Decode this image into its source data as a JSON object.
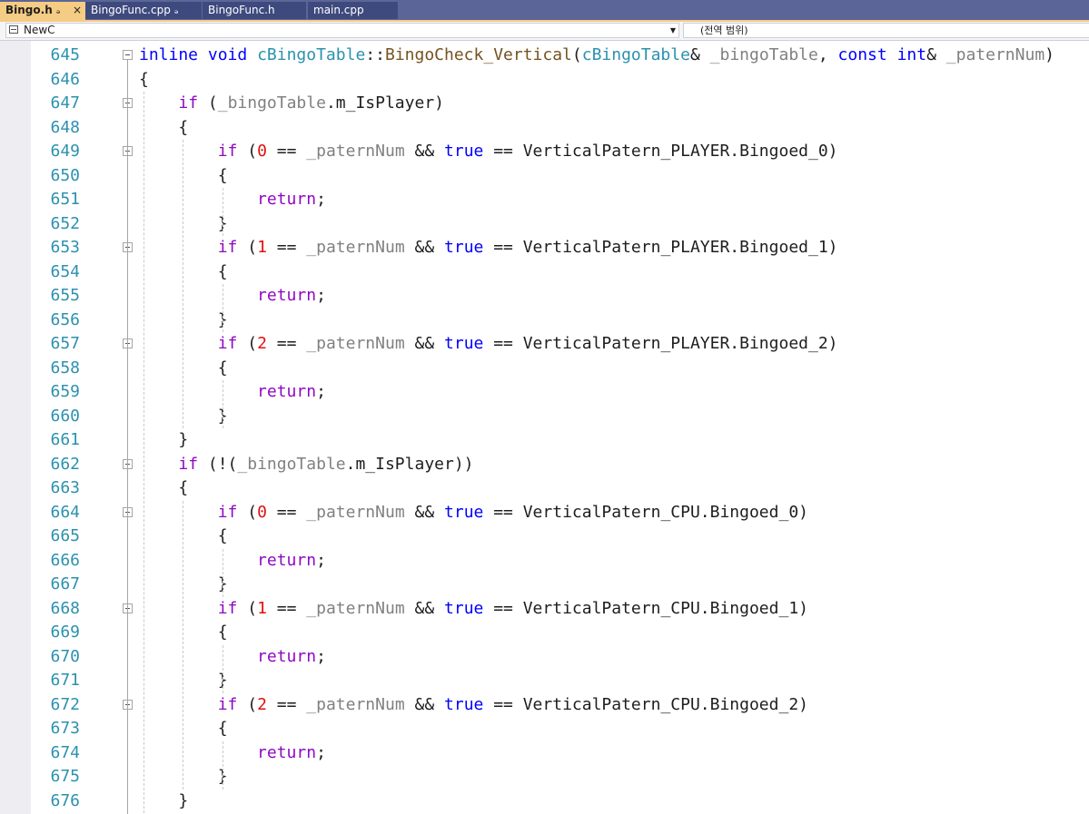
{
  "tabs": [
    {
      "label": "Bingo.h",
      "active": true,
      "pinned": true,
      "close": "×"
    },
    {
      "label": "BingoFunc.cpp",
      "active": false,
      "pinned": true
    },
    {
      "label": "BingoFunc.h",
      "active": false,
      "pinned": false
    },
    {
      "label": "main.cpp",
      "active": false,
      "pinned": false
    }
  ],
  "pin_glyph": "ₔ",
  "navbar": {
    "scope_left": "NewC",
    "scope_right": "(전역 범위)"
  },
  "colors": {
    "line_numbers": "#2b91af",
    "keyword": "#0000ff",
    "control_keyword": "#8f08c4",
    "type": "#2b91af",
    "parameter": "#808080",
    "number_literal": "#e01010"
  },
  "editor": {
    "lines": [
      {
        "num": "645",
        "fold": true,
        "tokens": [
          [
            "kw",
            "inline"
          ],
          [
            "plain",
            " "
          ],
          [
            "kw",
            "void"
          ],
          [
            "plain",
            " "
          ],
          [
            "type",
            "cBingoTable"
          ],
          [
            "plain",
            "::"
          ],
          [
            "func",
            "BingoCheck_Vertical"
          ],
          [
            "plain",
            "("
          ],
          [
            "type",
            "cBingoTable"
          ],
          [
            "plain",
            "& "
          ],
          [
            "param",
            "_bingoTable"
          ],
          [
            "plain",
            ", "
          ],
          [
            "kw",
            "const"
          ],
          [
            "plain",
            " "
          ],
          [
            "kw",
            "int"
          ],
          [
            "plain",
            "& "
          ],
          [
            "param",
            "_paternNum"
          ],
          [
            "plain",
            ")"
          ]
        ]
      },
      {
        "num": "646",
        "fold": false,
        "tokens": [
          [
            "plain",
            "{"
          ]
        ]
      },
      {
        "num": "647",
        "fold": true,
        "tokens": [
          [
            "plain",
            "    "
          ],
          [
            "ctl",
            "if"
          ],
          [
            "plain",
            " ("
          ],
          [
            "param",
            "_bingoTable"
          ],
          [
            "plain",
            ".m_IsPlayer)"
          ]
        ]
      },
      {
        "num": "648",
        "fold": false,
        "tokens": [
          [
            "plain",
            "    {"
          ]
        ]
      },
      {
        "num": "649",
        "fold": true,
        "tokens": [
          [
            "plain",
            "        "
          ],
          [
            "ctl",
            "if"
          ],
          [
            "plain",
            " ("
          ],
          [
            "num",
            "0"
          ],
          [
            "plain",
            " == "
          ],
          [
            "param",
            "_paternNum"
          ],
          [
            "plain",
            " && "
          ],
          [
            "kw",
            "true"
          ],
          [
            "plain",
            " == VerticalPatern_PLAYER.Bingoed_0)"
          ]
        ]
      },
      {
        "num": "650",
        "fold": false,
        "tokens": [
          [
            "plain",
            "        {"
          ]
        ]
      },
      {
        "num": "651",
        "fold": false,
        "tokens": [
          [
            "plain",
            "            "
          ],
          [
            "ctl",
            "return"
          ],
          [
            "plain",
            ";"
          ]
        ]
      },
      {
        "num": "652",
        "fold": false,
        "tokens": [
          [
            "plain",
            "        }"
          ]
        ]
      },
      {
        "num": "653",
        "fold": true,
        "tokens": [
          [
            "plain",
            "        "
          ],
          [
            "ctl",
            "if"
          ],
          [
            "plain",
            " ("
          ],
          [
            "num",
            "1"
          ],
          [
            "plain",
            " == "
          ],
          [
            "param",
            "_paternNum"
          ],
          [
            "plain",
            " && "
          ],
          [
            "kw",
            "true"
          ],
          [
            "plain",
            " == VerticalPatern_PLAYER.Bingoed_1)"
          ]
        ]
      },
      {
        "num": "654",
        "fold": false,
        "tokens": [
          [
            "plain",
            "        {"
          ]
        ]
      },
      {
        "num": "655",
        "fold": false,
        "tokens": [
          [
            "plain",
            "            "
          ],
          [
            "ctl",
            "return"
          ],
          [
            "plain",
            ";"
          ]
        ]
      },
      {
        "num": "656",
        "fold": false,
        "tokens": [
          [
            "plain",
            "        }"
          ]
        ]
      },
      {
        "num": "657",
        "fold": true,
        "tokens": [
          [
            "plain",
            "        "
          ],
          [
            "ctl",
            "if"
          ],
          [
            "plain",
            " ("
          ],
          [
            "num",
            "2"
          ],
          [
            "plain",
            " == "
          ],
          [
            "param",
            "_paternNum"
          ],
          [
            "plain",
            " && "
          ],
          [
            "kw",
            "true"
          ],
          [
            "plain",
            " == VerticalPatern_PLAYER.Bingoed_2)"
          ]
        ]
      },
      {
        "num": "658",
        "fold": false,
        "tokens": [
          [
            "plain",
            "        {"
          ]
        ]
      },
      {
        "num": "659",
        "fold": false,
        "tokens": [
          [
            "plain",
            "            "
          ],
          [
            "ctl",
            "return"
          ],
          [
            "plain",
            ";"
          ]
        ]
      },
      {
        "num": "660",
        "fold": false,
        "tokens": [
          [
            "plain",
            "        }"
          ]
        ]
      },
      {
        "num": "661",
        "fold": false,
        "tokens": [
          [
            "plain",
            "    }"
          ]
        ]
      },
      {
        "num": "662",
        "fold": true,
        "tokens": [
          [
            "plain",
            "    "
          ],
          [
            "ctl",
            "if"
          ],
          [
            "plain",
            " (!("
          ],
          [
            "param",
            "_bingoTable"
          ],
          [
            "plain",
            ".m_IsPlayer))"
          ]
        ]
      },
      {
        "num": "663",
        "fold": false,
        "tokens": [
          [
            "plain",
            "    {"
          ]
        ]
      },
      {
        "num": "664",
        "fold": true,
        "tokens": [
          [
            "plain",
            "        "
          ],
          [
            "ctl",
            "if"
          ],
          [
            "plain",
            " ("
          ],
          [
            "num",
            "0"
          ],
          [
            "plain",
            " == "
          ],
          [
            "param",
            "_paternNum"
          ],
          [
            "plain",
            " && "
          ],
          [
            "kw",
            "true"
          ],
          [
            "plain",
            " == VerticalPatern_CPU.Bingoed_0)"
          ]
        ]
      },
      {
        "num": "665",
        "fold": false,
        "tokens": [
          [
            "plain",
            "        {"
          ]
        ]
      },
      {
        "num": "666",
        "fold": false,
        "tokens": [
          [
            "plain",
            "            "
          ],
          [
            "ctl",
            "return"
          ],
          [
            "plain",
            ";"
          ]
        ]
      },
      {
        "num": "667",
        "fold": false,
        "tokens": [
          [
            "plain",
            "        }"
          ]
        ]
      },
      {
        "num": "668",
        "fold": true,
        "tokens": [
          [
            "plain",
            "        "
          ],
          [
            "ctl",
            "if"
          ],
          [
            "plain",
            " ("
          ],
          [
            "num",
            "1"
          ],
          [
            "plain",
            " == "
          ],
          [
            "param",
            "_paternNum"
          ],
          [
            "plain",
            " && "
          ],
          [
            "kw",
            "true"
          ],
          [
            "plain",
            " == VerticalPatern_CPU.Bingoed_1)"
          ]
        ]
      },
      {
        "num": "669",
        "fold": false,
        "tokens": [
          [
            "plain",
            "        {"
          ]
        ]
      },
      {
        "num": "670",
        "fold": false,
        "tokens": [
          [
            "plain",
            "            "
          ],
          [
            "ctl",
            "return"
          ],
          [
            "plain",
            ";"
          ]
        ]
      },
      {
        "num": "671",
        "fold": false,
        "tokens": [
          [
            "plain",
            "        }"
          ]
        ]
      },
      {
        "num": "672",
        "fold": true,
        "tokens": [
          [
            "plain",
            "        "
          ],
          [
            "ctl",
            "if"
          ],
          [
            "plain",
            " ("
          ],
          [
            "num",
            "2"
          ],
          [
            "plain",
            " == "
          ],
          [
            "param",
            "_paternNum"
          ],
          [
            "plain",
            " && "
          ],
          [
            "kw",
            "true"
          ],
          [
            "plain",
            " == VerticalPatern_CPU.Bingoed_2)"
          ]
        ]
      },
      {
        "num": "673",
        "fold": false,
        "tokens": [
          [
            "plain",
            "        {"
          ]
        ]
      },
      {
        "num": "674",
        "fold": false,
        "tokens": [
          [
            "plain",
            "            "
          ],
          [
            "ctl",
            "return"
          ],
          [
            "plain",
            ";"
          ]
        ]
      },
      {
        "num": "675",
        "fold": false,
        "tokens": [
          [
            "plain",
            "        }"
          ]
        ]
      },
      {
        "num": "676",
        "fold": false,
        "tokens": [
          [
            "plain",
            "    }"
          ]
        ]
      }
    ]
  }
}
